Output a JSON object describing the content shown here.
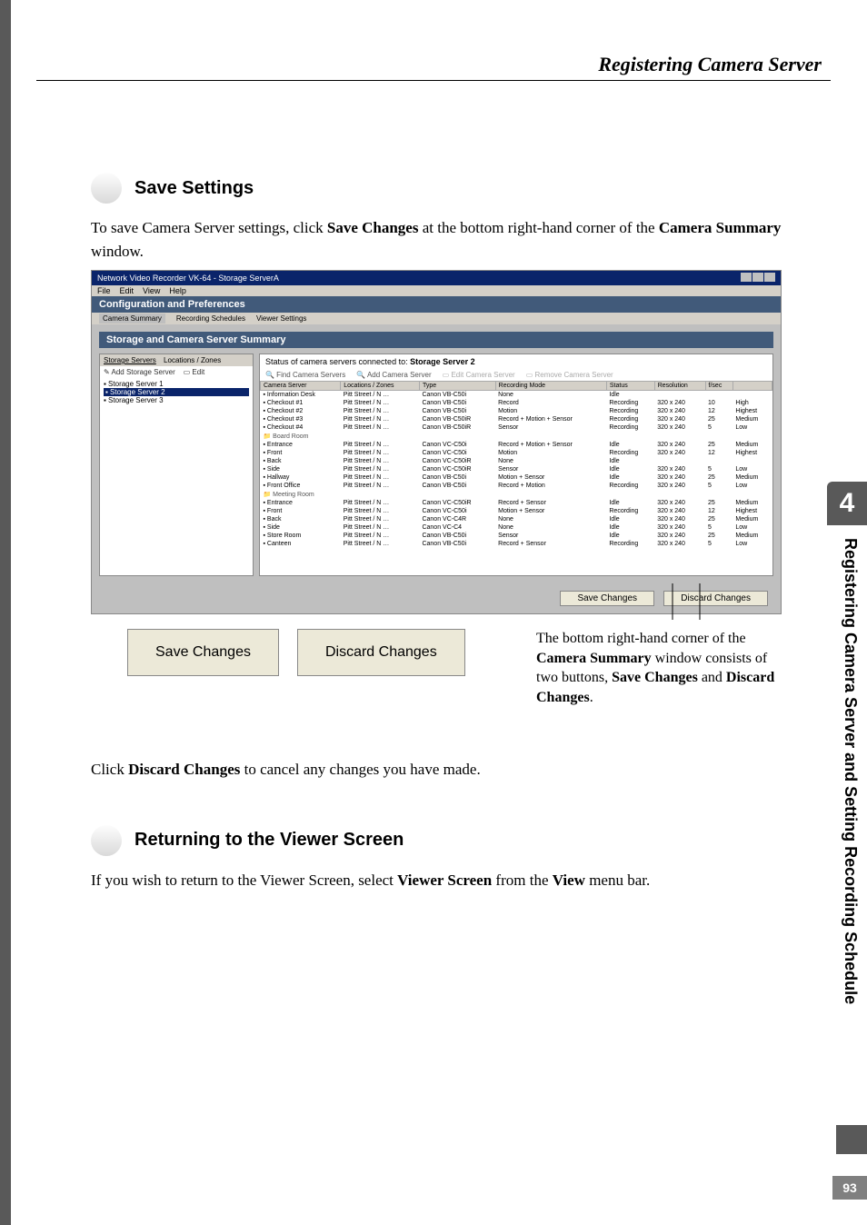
{
  "header": {
    "title": "Registering Camera Server"
  },
  "chapter": {
    "number": "4",
    "side_title": "Registering Camera Server and Setting Recording Schedule",
    "page_number": "93"
  },
  "section1": {
    "heading": "Save Settings",
    "para_before": "To save Camera Server settings, click ",
    "para_bold1": "Save Changes",
    "para_mid": " at the bottom right-hand corner of the ",
    "para_bold2": "Camera Summary",
    "para_after": " window."
  },
  "screenshot": {
    "window_title": "Network Video Recorder VK-64 - Storage ServerA",
    "menus": [
      "File",
      "Edit",
      "View",
      "Help"
    ],
    "conf_header": "Configuration and Preferences",
    "subtabs": [
      "Camera Summary",
      "Recording Schedules",
      "Viewer Settings"
    ],
    "panel_header": "Storage and Camera Server Summary",
    "left_tabs": [
      "Storage Servers",
      "Locations / Zones"
    ],
    "left_toolbar": {
      "add": "Add Storage Server",
      "edit": "Edit"
    },
    "storage_servers": [
      "Storage Server 1",
      "Storage Server 2",
      "Storage Server 3"
    ],
    "status_line_prefix": "Status of camera servers connected to: ",
    "status_line_server": "Storage Server 2",
    "right_toolbar": [
      "Find Camera Servers",
      "Add Camera Server",
      "Edit Camera Server",
      "Remove Camera Server"
    ],
    "columns": [
      "Camera Server",
      "Locations / Zones",
      "Type",
      "Recording Mode",
      "Status",
      "Resolution",
      "f/sec",
      ""
    ],
    "rows": [
      {
        "name": "Information Desk",
        "loc": "Pitt Street / N …",
        "type": "Canon VB-C50i",
        "mode": "None",
        "status": "Idle",
        "res": "",
        "fps": "",
        "q": ""
      },
      {
        "name": "Checkout #1",
        "loc": "Pitt Street / N …",
        "type": "Canon VB-C50i",
        "mode": "Record",
        "status": "Recording",
        "res": "320 x 240",
        "fps": "10",
        "q": "High"
      },
      {
        "name": "Checkout #2",
        "loc": "Pitt Street / N …",
        "type": "Canon VB-C50i",
        "mode": "Motion",
        "status": "Recording",
        "res": "320 x 240",
        "fps": "12",
        "q": "Highest"
      },
      {
        "name": "Checkout #3",
        "loc": "Pitt Street / N …",
        "type": "Canon VB-C50iR",
        "mode": "Record + Motion + Sensor",
        "status": "Recording",
        "res": "320 x 240",
        "fps": "25",
        "q": "Medium"
      },
      {
        "name": "Checkout #4",
        "loc": "Pitt Street / N …",
        "type": "Canon VB-C50iR",
        "mode": "Sensor",
        "status": "Recording",
        "res": "320 x 240",
        "fps": "5",
        "q": "Low"
      },
      {
        "folder": true,
        "name": "Board Room"
      },
      {
        "name": "Entrance",
        "loc": "Pitt Street / N …",
        "type": "Canon VC-C50i",
        "mode": "Record + Motion + Sensor",
        "status": "Idle",
        "res": "320 x 240",
        "fps": "25",
        "q": "Medium"
      },
      {
        "name": "Front",
        "loc": "Pitt Street / N …",
        "type": "Canon VC-C50i",
        "mode": "Motion",
        "status": "Recording",
        "res": "320 x 240",
        "fps": "12",
        "q": "Highest"
      },
      {
        "name": "Back",
        "loc": "Pitt Street / N …",
        "type": "Canon VC-C50iR",
        "mode": "None",
        "status": "Idle",
        "res": "",
        "fps": "",
        "q": ""
      },
      {
        "name": "Side",
        "loc": "Pitt Street / N …",
        "type": "Canon VC-C50iR",
        "mode": "Sensor",
        "status": "Idle",
        "res": "320 x 240",
        "fps": "5",
        "q": "Low"
      },
      {
        "name": "Hallway",
        "loc": "Pitt Street / N …",
        "type": "Canon VB-C50i",
        "mode": "Motion + Sensor",
        "status": "Idle",
        "res": "320 x 240",
        "fps": "25",
        "q": "Medium"
      },
      {
        "name": "Front Office",
        "loc": "Pitt Street / N …",
        "type": "Canon VB-C50i",
        "mode": "Record + Motion",
        "status": "Recording",
        "res": "320 x 240",
        "fps": "5",
        "q": "Low"
      },
      {
        "folder": true,
        "name": "Meeting Room"
      },
      {
        "name": "Entrance",
        "loc": "Pitt Street / N …",
        "type": "Canon VC-C50iR",
        "mode": "Record + Sensor",
        "status": "Idle",
        "res": "320 x 240",
        "fps": "25",
        "q": "Medium"
      },
      {
        "name": "Front",
        "loc": "Pitt Street / N …",
        "type": "Canon VC-C50i",
        "mode": "Motion + Sensor",
        "status": "Recording",
        "res": "320 x 240",
        "fps": "12",
        "q": "Highest"
      },
      {
        "name": "Back",
        "loc": "Pitt Street / N …",
        "type": "Canon VC-C4R",
        "mode": "None",
        "status": "Idle",
        "res": "320 x 240",
        "fps": "25",
        "q": "Medium"
      },
      {
        "name": "Side",
        "loc": "Pitt Street / N …",
        "type": "Canon VC-C4",
        "mode": "None",
        "status": "Idle",
        "res": "320 x 240",
        "fps": "5",
        "q": "Low"
      },
      {
        "name": "Store Room",
        "loc": "Pitt Street / N …",
        "type": "Canon VB-C50i",
        "mode": "Sensor",
        "status": "Idle",
        "res": "320 x 240",
        "fps": "25",
        "q": "Medium"
      },
      {
        "name": "Canteen",
        "loc": "Pitt Street / N …",
        "type": "Canon VB-C50i",
        "mode": "Record + Sensor",
        "status": "Recording",
        "res": "320 x 240",
        "fps": "5",
        "q": "Low"
      }
    ],
    "buttons": {
      "save": "Save Changes",
      "discard": "Discard Changes"
    }
  },
  "callout": {
    "btn_save": "Save Changes",
    "btn_discard": "Discard Changes",
    "text_before": "The bottom right-hand corner of the ",
    "text_b1": "Camera Summary",
    "text_mid1": " window consists of two buttons, ",
    "text_b2": "Save Changes",
    "text_mid2": " and ",
    "text_b3": "Discard Changes",
    "text_after": "."
  },
  "para2": {
    "before": "Click ",
    "bold": "Discard Changes",
    "after": " to cancel any changes you have made."
  },
  "section2": {
    "heading": "Returning to the Viewer Screen",
    "para_before": "If you wish to return to the Viewer Screen, select ",
    "para_b1": "Viewer Screen",
    "para_mid": " from the ",
    "para_b2": "View",
    "para_after": " menu bar."
  }
}
